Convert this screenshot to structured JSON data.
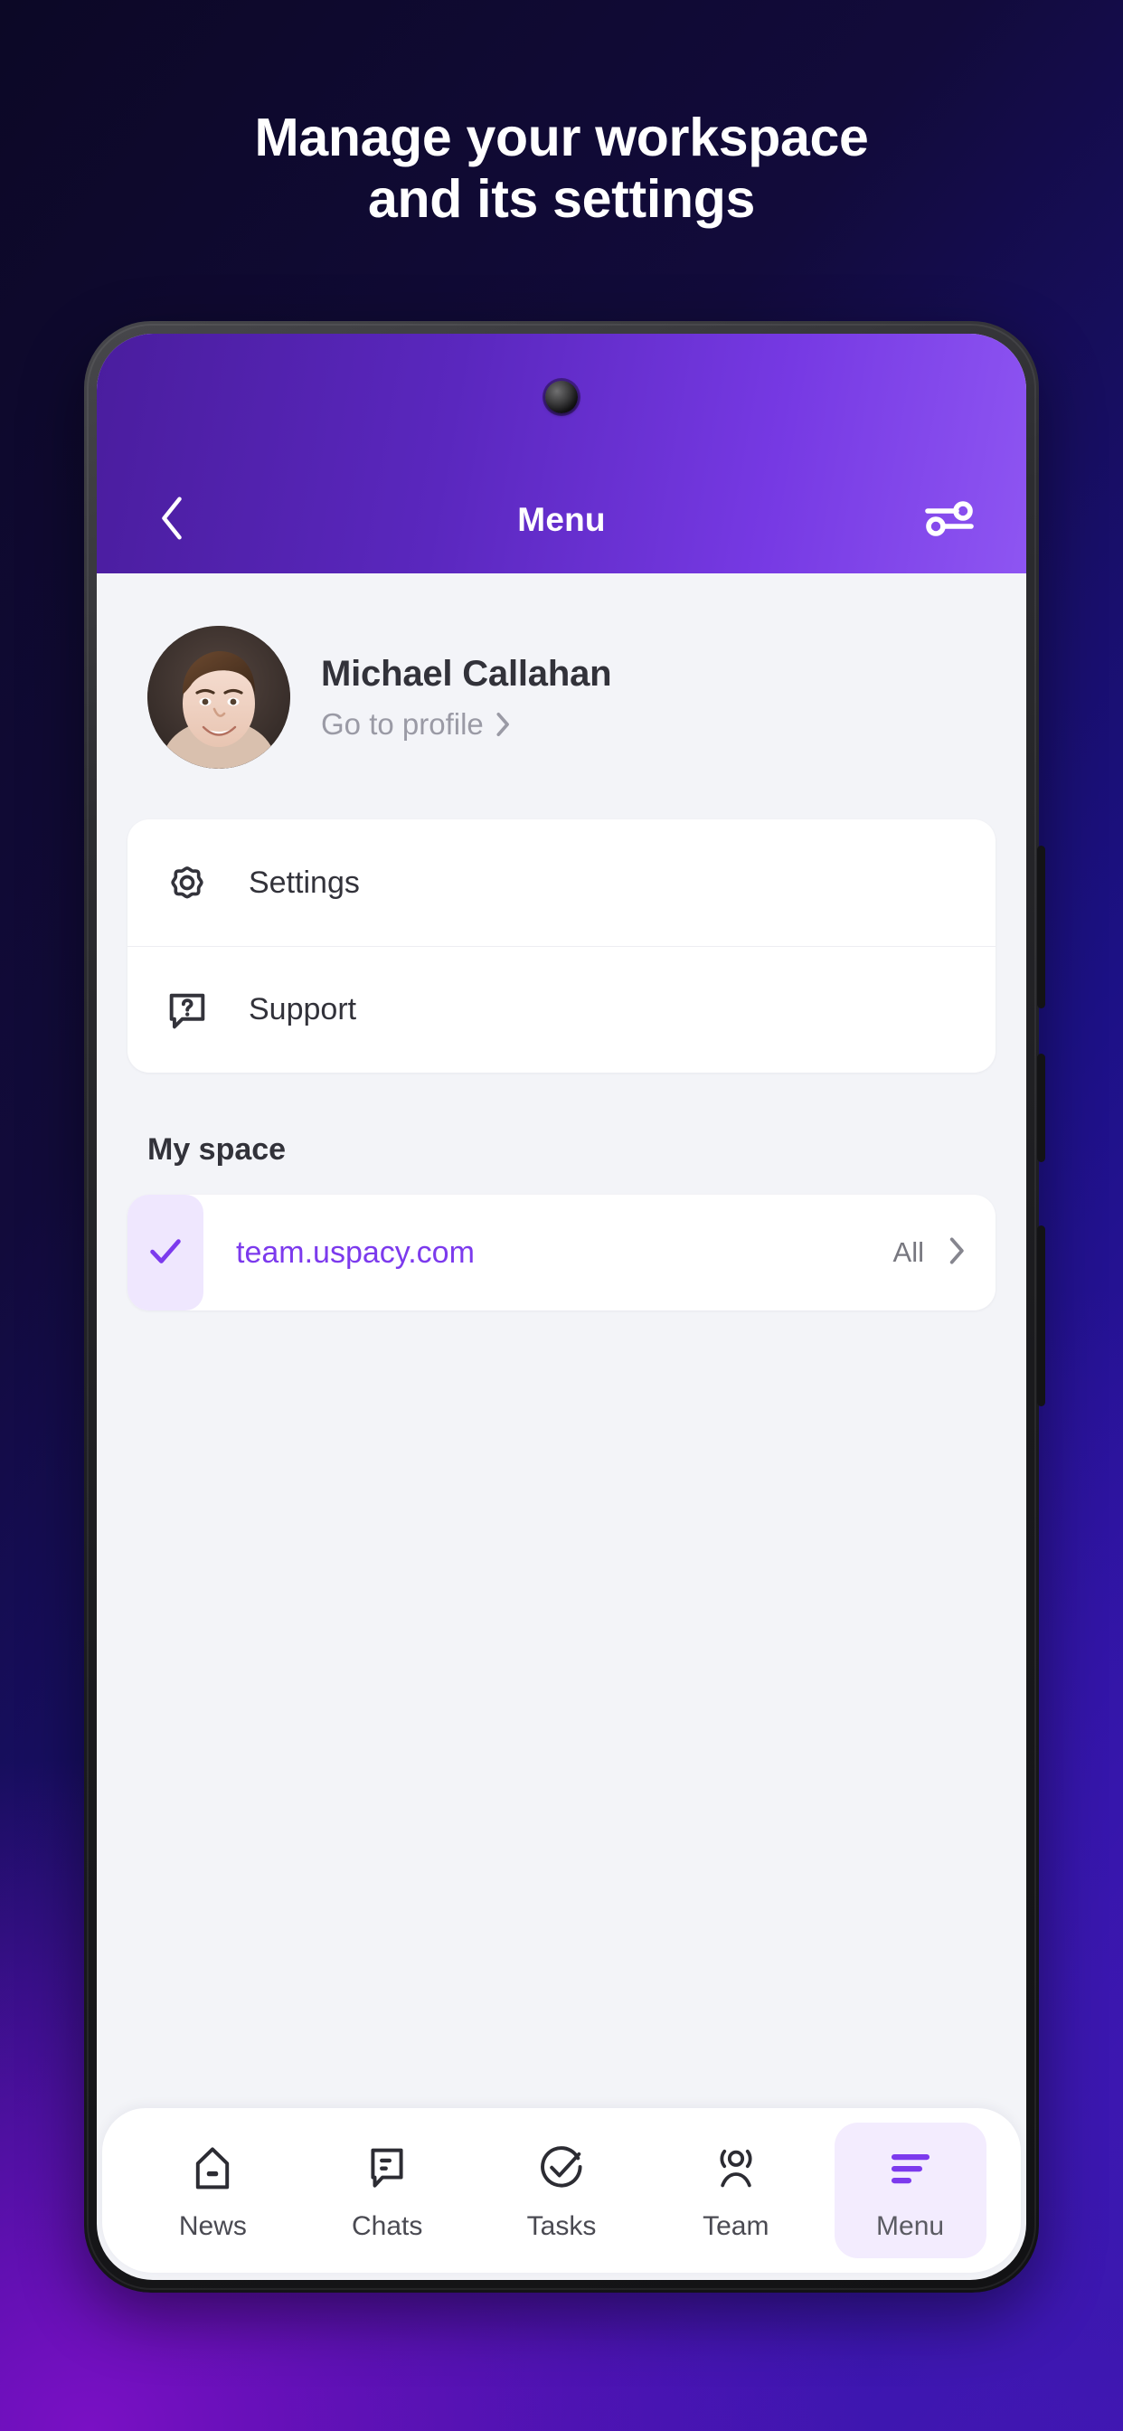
{
  "promo": {
    "headline_line1": "Manage your workspace",
    "headline_line2": "and its settings"
  },
  "colors": {
    "accent_purple": "#7C3AED",
    "appbar_gradient_from": "#4A1D9E",
    "appbar_gradient_to": "#8E55F2",
    "screen_background": "#F3F4F8",
    "card_background": "#FFFFFF",
    "active_nav_pill": "#F3ECFE",
    "check_tile": "#EFE7FE"
  },
  "appbar": {
    "title": "Menu",
    "back_icon": "chevron-left-icon",
    "settings_icon": "sliders-icon"
  },
  "profile": {
    "name": "Michael Callahan",
    "link_label": "Go to profile",
    "link_chevron": "chevron-right-icon",
    "avatar_alt": "avatar"
  },
  "menu": {
    "items": [
      {
        "label": "Settings",
        "icon": "gear-icon"
      },
      {
        "label": "Support",
        "icon": "question-chat-icon"
      }
    ]
  },
  "my_space": {
    "section_title": "My space",
    "items": [
      {
        "name": "team.uspacy.com",
        "badge": "All",
        "check_icon": "check-icon",
        "chevron": "chevron-right-icon",
        "selected": true
      }
    ]
  },
  "bottom_nav": {
    "items": [
      {
        "label": "News",
        "icon": "home-icon",
        "active": false
      },
      {
        "label": "Chats",
        "icon": "chat-icon",
        "active": false
      },
      {
        "label": "Tasks",
        "icon": "check-circle-icon",
        "active": false
      },
      {
        "label": "Team",
        "icon": "people-icon",
        "active": false
      },
      {
        "label": "Menu",
        "icon": "hamburger-icon",
        "active": true
      }
    ]
  }
}
